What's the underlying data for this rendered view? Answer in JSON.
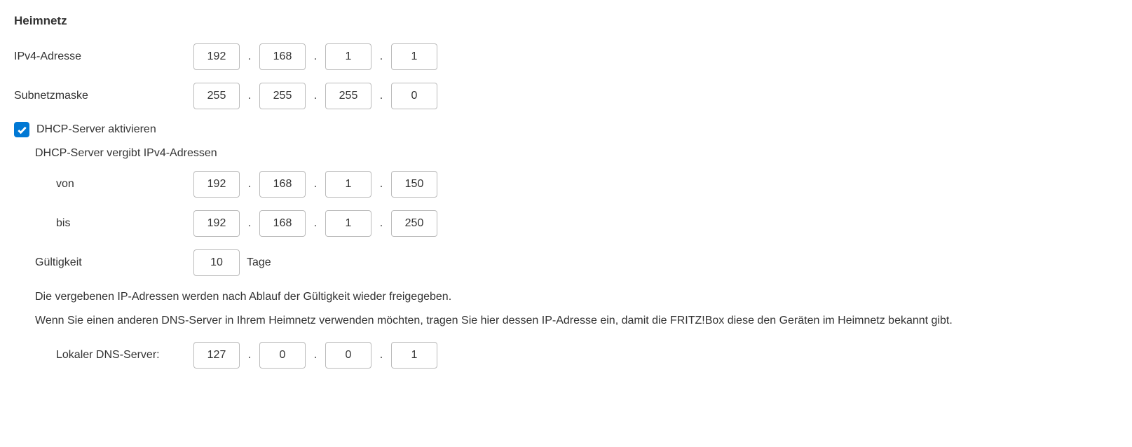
{
  "heading": "Heimnetz",
  "ipv4": {
    "label": "IPv4-Adresse",
    "octets": [
      "192",
      "168",
      "1",
      "1"
    ]
  },
  "subnet": {
    "label": "Subnetzmaske",
    "octets": [
      "255",
      "255",
      "255",
      "0"
    ]
  },
  "dhcp": {
    "checkbox_label": "DHCP-Server aktivieren",
    "checked": true,
    "range_label": "DHCP-Server vergibt IPv4-Adressen",
    "from": {
      "label": "von",
      "octets": [
        "192",
        "168",
        "1",
        "150"
      ]
    },
    "to": {
      "label": "bis",
      "octets": [
        "192",
        "168",
        "1",
        "250"
      ]
    },
    "validity": {
      "label": "Gültigkeit",
      "value": "10",
      "unit": "Tage"
    },
    "info1": "Die vergebenen IP-Adressen werden nach Ablauf der Gültigkeit wieder freigegeben.",
    "info2": "Wenn Sie einen anderen DNS-Server in Ihrem Heimnetz verwenden möchten, tragen Sie hier dessen IP-Adresse ein, damit die FRITZ!Box diese den Geräten im Heimnetz bekannt gibt.",
    "local_dns": {
      "label": "Lokaler DNS-Server:",
      "octets": [
        "127",
        "0",
        "0",
        "1"
      ]
    }
  },
  "dot": "."
}
